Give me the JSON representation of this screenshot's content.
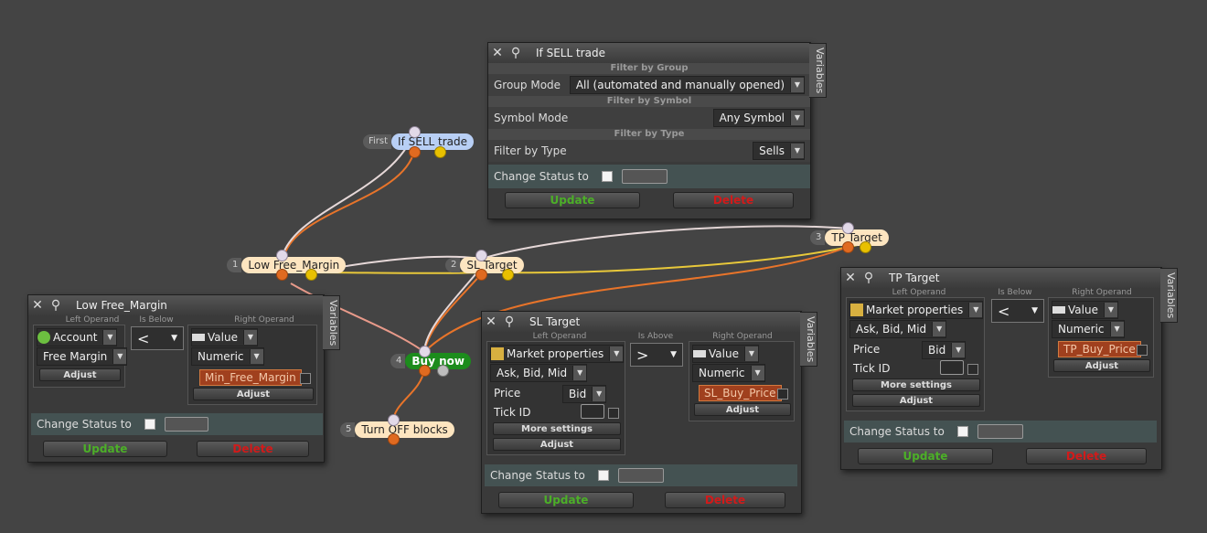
{
  "colors": {
    "background": "#444444",
    "update": "#4caf28",
    "delete": "#d21a1a",
    "node_label": "#fde5c0",
    "node_first": "#b8cff5",
    "node_action": "#1c8c1c",
    "wire_orange": "#e8742a",
    "wire_yellow": "#e8c83a",
    "wire_white": "#e6d8d8"
  },
  "nodes": [
    {
      "num": "First",
      "label": "If SELL trade"
    },
    {
      "num": "1",
      "label": "Low Free_Margin"
    },
    {
      "num": "2",
      "label": "SL Target"
    },
    {
      "num": "3",
      "label": "TP Target"
    },
    {
      "num": "4",
      "label": "Buy now"
    },
    {
      "num": "5",
      "label": "Turn OFF blocks"
    }
  ],
  "common": {
    "variables_tab": "Variables",
    "change_status": "Change Status to",
    "update": "Update",
    "delete": "Delete",
    "adjust": "Adjust",
    "more_settings": "More settings",
    "left_operand": "Left Operand",
    "right_operand": "Right Operand",
    "close_icon": "close-icon",
    "pin_icon": "pin-icon"
  },
  "if_sell": {
    "title": "If SELL trade",
    "filter_group_head": "Filter by Group",
    "group_mode_label": "Group Mode",
    "group_mode_value": "All (automated and manually opened)",
    "filter_symbol_head": "Filter by Symbol",
    "symbol_mode_label": "Symbol Mode",
    "symbol_mode_value": "Any Symbol",
    "filter_type_head": "Filter by Type",
    "filter_type_label": "Filter by Type",
    "filter_type_value": "Sells"
  },
  "low_free_margin": {
    "title": "Low Free_Margin",
    "comparison": "Is Below",
    "left_type": "Account",
    "left_value": "Free Margin",
    "operator": "<",
    "right_type": "Value",
    "right_format": "Numeric",
    "right_variable": "Min_Free_Margin"
  },
  "sl_target": {
    "title": "SL Target",
    "comparison": "Is Above",
    "left_type": "Market properties",
    "left_value": "Ask, Bid, Mid",
    "price_label": "Price",
    "price_value": "Bid",
    "tick_label": "Tick ID",
    "operator": ">",
    "right_type": "Value",
    "right_format": "Numeric",
    "right_variable": "SL_Buy_Price"
  },
  "tp_target": {
    "title": "TP Target",
    "comparison": "Is Below",
    "left_type": "Market properties",
    "left_value": "Ask, Bid, Mid",
    "price_label": "Price",
    "price_value": "Bid",
    "tick_label": "Tick ID",
    "operator": "<",
    "right_type": "Value",
    "right_format": "Numeric",
    "right_variable": "TP_Buy_Price"
  }
}
